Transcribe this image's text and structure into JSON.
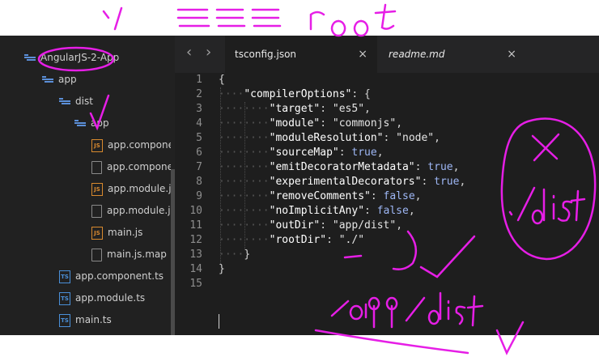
{
  "annotations": {
    "top_note": "/ === root",
    "side_note": "./dist",
    "bottom_note": "/app/dist"
  },
  "sidebar": {
    "items": [
      {
        "label": "AngularJS-2-App",
        "icon": "folder-icon"
      },
      {
        "label": "app",
        "icon": "folder-icon"
      },
      {
        "label": "dist",
        "icon": "folder-icon"
      },
      {
        "label": "app",
        "icon": "folder-icon"
      },
      {
        "label": "app.component.js",
        "icon": "js-file-icon"
      },
      {
        "label": "app.component.js.map",
        "icon": "file-icon"
      },
      {
        "label": "app.module.js",
        "icon": "js-file-icon"
      },
      {
        "label": "app.module.js.map",
        "icon": "file-icon"
      },
      {
        "label": "main.js",
        "icon": "js-file-icon"
      },
      {
        "label": "main.js.map",
        "icon": "file-icon"
      },
      {
        "label": "app.component.ts",
        "icon": "ts-file-icon"
      },
      {
        "label": "app.module.ts",
        "icon": "ts-file-icon"
      },
      {
        "label": "main.ts",
        "icon": "ts-file-icon"
      }
    ]
  },
  "tabs": [
    {
      "label": "tsconfig.json",
      "close": "×"
    },
    {
      "label": "readme.md",
      "close": "×"
    }
  ],
  "nav": {
    "back": "‹",
    "forward": "›"
  },
  "code": {
    "lines": [
      {
        "n": "1",
        "ws": "",
        "text": "{"
      },
      {
        "n": "2",
        "ws": "····",
        "text": "\"compilerOptions\": {"
      },
      {
        "n": "3",
        "ws": "········",
        "text": "\"target\": \"es5\","
      },
      {
        "n": "4",
        "ws": "········",
        "text": "\"module\": \"commonjs\","
      },
      {
        "n": "5",
        "ws": "········",
        "text": "\"moduleResolution\": \"node\","
      },
      {
        "n": "6",
        "ws": "········",
        "text": "\"sourceMap\": true,"
      },
      {
        "n": "7",
        "ws": "········",
        "text": "\"emitDecoratorMetadata\": true,"
      },
      {
        "n": "8",
        "ws": "········",
        "text": "\"experimentalDecorators\": true,"
      },
      {
        "n": "9",
        "ws": "········",
        "text": "\"removeComments\": false,"
      },
      {
        "n": "10",
        "ws": "········",
        "text": "\"noImplicitAny\": false,"
      },
      {
        "n": "11",
        "ws": "········",
        "text": "\"outDir\": \"app/dist\","
      },
      {
        "n": "12",
        "ws": "········",
        "text": "\"rootDir\": \"./\""
      },
      {
        "n": "13",
        "ws": "····",
        "text": "}"
      },
      {
        "n": "14",
        "ws": "",
        "text": "}"
      },
      {
        "n": "15",
        "ws": "",
        "text": ""
      }
    ]
  },
  "colors": {
    "annotation": "#e61ee6",
    "editor_bg": "#1e1e1e",
    "sidebar_bg": "#212121"
  }
}
